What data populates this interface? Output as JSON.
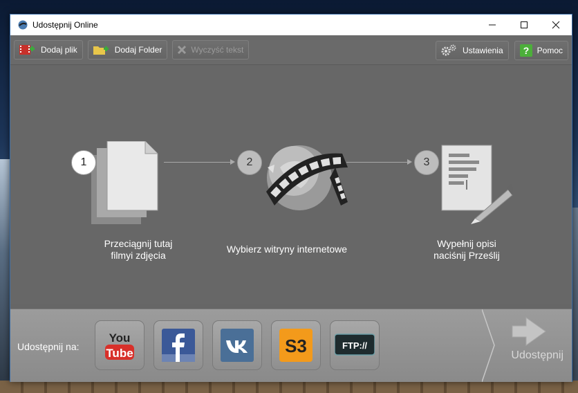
{
  "window": {
    "title": "Udostępnij Online"
  },
  "toolbar": {
    "add_file": "Dodaj plik",
    "add_folder": "Dodaj Folder",
    "clear_text": "Wyczyść tekst",
    "settings": "Ustawienia",
    "help": "Pomoc"
  },
  "steps": [
    {
      "number": "1",
      "caption_line1": "Przeciągnij tutaj",
      "caption_line2": "filmyi zdjęcia"
    },
    {
      "number": "2",
      "caption_line1": "Wybierz witryny internetowe",
      "caption_line2": ""
    },
    {
      "number": "3",
      "caption_line1": "Wypełnij opisi",
      "caption_line2": "naciśnij Prześlij"
    }
  ],
  "share": {
    "label": "Udostępnij na:",
    "services": [
      "YouTube",
      "Facebook",
      "VK",
      "S3",
      "FTP"
    ],
    "ftp_text": "FTP://",
    "s3_text": "S3",
    "send_label": "Udostępnij"
  },
  "colors": {
    "youtube_red": "#d8302a",
    "facebook_blue": "#3b5998",
    "vk_blue": "#4a6f97",
    "s3_orange": "#f39a1b",
    "ftp_dark": "#1e2b2e"
  }
}
